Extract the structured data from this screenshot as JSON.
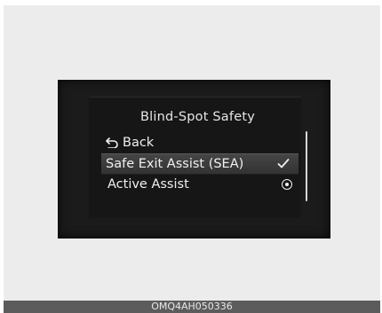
{
  "menu": {
    "title": "Blind-Spot Safety",
    "items": [
      {
        "label": "Back",
        "icon": "back-arrow-icon"
      },
      {
        "label": "Safe Exit Assist (SEA)",
        "icon": "checkmark-icon",
        "selected": true
      },
      {
        "label": "Active Assist",
        "icon": "radio-button-icon",
        "checked": true
      }
    ]
  },
  "footer": {
    "code": "OMQ4AH050336"
  },
  "colors": {
    "frame_background": "#ececec",
    "screen_background": "#1b1b1b",
    "highlight_row": "#3c3c3c",
    "text": "#f0f0f0",
    "footer_bar": "#5c5c5c"
  }
}
